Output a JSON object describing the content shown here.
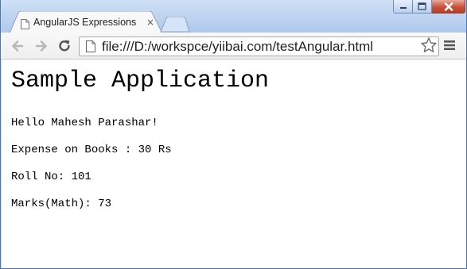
{
  "browser": {
    "tab_title": "AngularJS Expressions",
    "tab_close_glyph": "×",
    "url": "file:///D:/workspce/yiibai.com/testAngular.html",
    "icons": [
      "page-icon",
      "back-arrow-icon",
      "forward-arrow-icon",
      "reload-icon",
      "star-icon",
      "menu-icon",
      "minimize-icon",
      "maximize-icon",
      "close-icon"
    ]
  },
  "page": {
    "heading": "Sample Application",
    "lines": [
      "Hello Mahesh Parashar!",
      "Expense on Books : 30 Rs",
      "Roll No: 101",
      "Marks(Math): 73"
    ]
  },
  "colors": {
    "window_frame": "#b9cfee",
    "close_button": "#c9503a"
  }
}
